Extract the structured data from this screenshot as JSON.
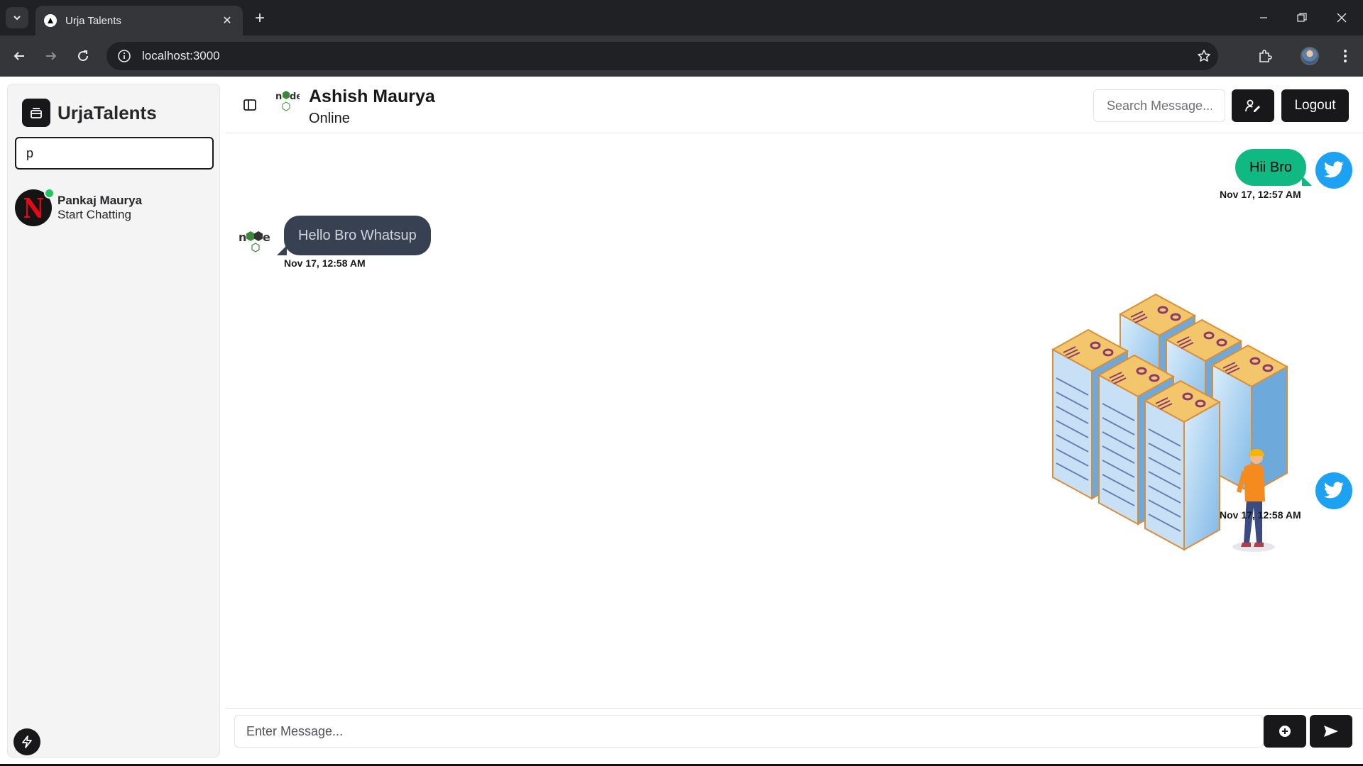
{
  "browser": {
    "tab_title": "Urja Talents",
    "url": "localhost:3000",
    "colors": {
      "frame": "#202124",
      "toolbar": "#35363a"
    }
  },
  "sidebar": {
    "brand": "UrjaTalents",
    "search_value": "p",
    "contacts": [
      {
        "name": "Pankaj Maurya",
        "subtitle": "Start Chatting",
        "avatar": "netflix-logo",
        "online": true
      }
    ]
  },
  "header": {
    "name": "Ashish Maurya",
    "status": "Online",
    "search_placeholder": "Search Message...",
    "logout_label": "Logout"
  },
  "messages": [
    {
      "direction": "sent",
      "text": "Hii Bro",
      "time": "Nov 17, 12:57 AM",
      "avatar": "twitter-bird"
    },
    {
      "direction": "received",
      "text": "Hello Bro Whatsup",
      "time": "Nov 17, 12:58 AM",
      "avatar": "nodejs-logo"
    },
    {
      "direction": "sent",
      "type": "image",
      "image": "isometric-servers-with-engineer",
      "time": "Nov 17, 12:58 AM",
      "avatar": "twitter-bird"
    }
  ],
  "composer": {
    "placeholder": "Enter Message..."
  },
  "colors": {
    "sent_bubble": "#10b981",
    "received_bubble": "#374151",
    "primary_button": "#18181b",
    "online_dot": "#22c55e",
    "twitter_blue": "#1da1f2"
  }
}
